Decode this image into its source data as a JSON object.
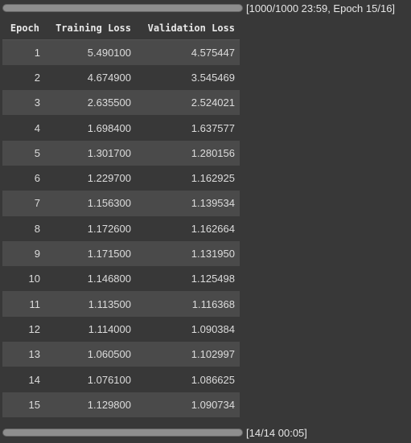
{
  "progress_top": {
    "label": "[1000/1000 23:59, Epoch 15/16]",
    "fraction": 1.0
  },
  "table": {
    "columns": [
      "Epoch",
      "Training Loss",
      "Validation Loss"
    ],
    "rows": [
      [
        "1",
        "5.490100",
        "4.575447"
      ],
      [
        "2",
        "4.674900",
        "3.545469"
      ],
      [
        "3",
        "2.635500",
        "2.524021"
      ],
      [
        "4",
        "1.698400",
        "1.637577"
      ],
      [
        "5",
        "1.301700",
        "1.280156"
      ],
      [
        "6",
        "1.229700",
        "1.162925"
      ],
      [
        "7",
        "1.156300",
        "1.139534"
      ],
      [
        "8",
        "1.172600",
        "1.162664"
      ],
      [
        "9",
        "1.171500",
        "1.131950"
      ],
      [
        "10",
        "1.146800",
        "1.125498"
      ],
      [
        "11",
        "1.113500",
        "1.116368"
      ],
      [
        "12",
        "1.114000",
        "1.090384"
      ],
      [
        "13",
        "1.060500",
        "1.102997"
      ],
      [
        "14",
        "1.076100",
        "1.086625"
      ],
      [
        "15",
        "1.129800",
        "1.090734"
      ]
    ]
  },
  "progress_bottom": {
    "label": "[14/14 00:05]",
    "fraction": 1.0
  }
}
